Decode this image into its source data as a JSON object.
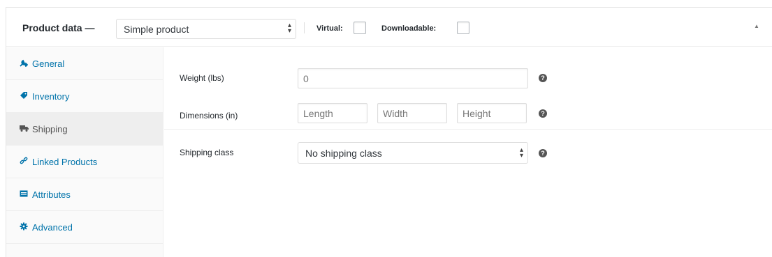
{
  "header": {
    "title": "Product data —",
    "product_type": "Simple product",
    "virtual_label": "Virtual:",
    "virtual_checked": false,
    "downloadable_label": "Downloadable:",
    "downloadable_checked": false
  },
  "tabs": [
    {
      "label": "General",
      "icon": "wrench-icon",
      "active": false
    },
    {
      "label": "Inventory",
      "icon": "tag-icon",
      "active": false
    },
    {
      "label": "Shipping",
      "icon": "truck-icon",
      "active": true
    },
    {
      "label": "Linked Products",
      "icon": "link-icon",
      "active": false
    },
    {
      "label": "Attributes",
      "icon": "table-icon",
      "active": false
    },
    {
      "label": "Advanced",
      "icon": "gear-icon",
      "active": false
    }
  ],
  "shipping": {
    "weight_label": "Weight (lbs)",
    "weight_placeholder": "0",
    "dimensions_label": "Dimensions (in)",
    "length_placeholder": "Length",
    "width_placeholder": "Width",
    "height_placeholder": "Height",
    "class_label": "Shipping class",
    "class_value": "No shipping class"
  },
  "colors": {
    "link": "#0073aa",
    "active_tab_bg": "#eeeeee"
  }
}
